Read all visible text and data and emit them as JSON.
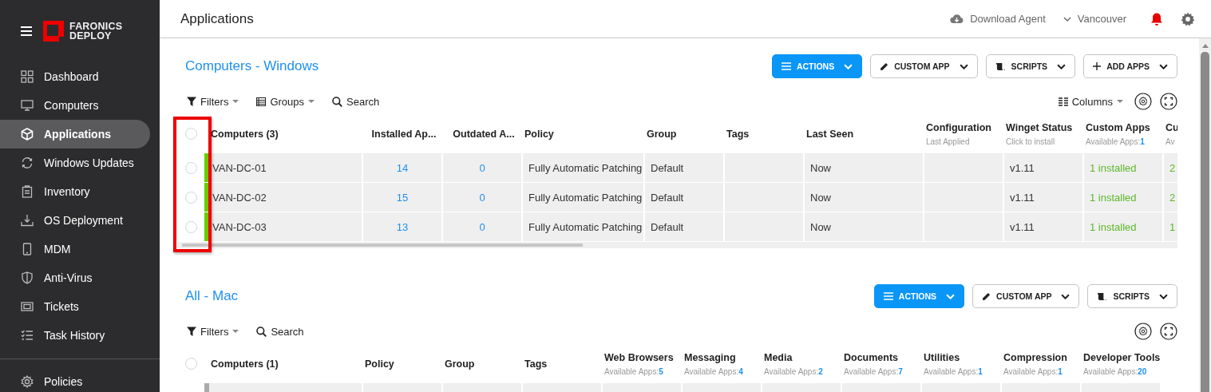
{
  "sidebar": {
    "logo": {
      "line_1": "FARONICS",
      "line_2": "DEPLOY"
    },
    "items": [
      {
        "label": "Dashboard",
        "kind": "dashboard",
        "selected": false
      },
      {
        "label": "Computers",
        "kind": "computers",
        "selected": false
      },
      {
        "label": "Applications",
        "kind": "applications",
        "selected": true
      },
      {
        "label": "Windows Updates",
        "kind": "updates",
        "selected": false
      },
      {
        "label": "Inventory",
        "kind": "inventory",
        "selected": false
      },
      {
        "label": "OS Deployment",
        "kind": "deployment",
        "selected": false
      },
      {
        "label": "MDM",
        "kind": "mdm",
        "selected": false
      },
      {
        "label": "Anti-Virus",
        "kind": "antivirus",
        "selected": false
      },
      {
        "label": "Tickets",
        "kind": "tickets",
        "selected": false
      },
      {
        "label": "Task History",
        "kind": "history",
        "selected": false
      }
    ],
    "footer_items": [
      {
        "label": "Policies",
        "kind": "policies",
        "selected": false
      }
    ]
  },
  "header": {
    "title": "Applications",
    "download_label": "Download Agent",
    "location": "Vancouver"
  },
  "sections": [
    {
      "title": "Computers - Windows",
      "buttons": [
        {
          "label": "ACTIONS",
          "kind": "actions"
        },
        {
          "label": "CUSTOM APP",
          "kind": "custom"
        },
        {
          "label": "SCRIPTS",
          "kind": "scripts"
        },
        {
          "label": "ADD APPS",
          "kind": "add"
        }
      ],
      "toolbar": [
        {
          "label": "Filters",
          "kind": "filters"
        },
        {
          "label": "Groups",
          "kind": "groups"
        },
        {
          "label": "Search",
          "kind": "search"
        }
      ],
      "columns_menu": {
        "label": "Columns"
      },
      "table": {
        "select_all": {
          "selected": false
        },
        "columns": [
          {
            "label": "Computers (3)",
            "kind": "name"
          },
          {
            "label": "Installed Ap...",
            "kind": "link"
          },
          {
            "label": "Outdated A...",
            "kind": "link"
          },
          {
            "label": "Policy",
            "kind": "text"
          },
          {
            "label": "Group",
            "kind": "text"
          },
          {
            "label": "Tags",
            "kind": "text"
          },
          {
            "label": "Last Seen",
            "kind": "text"
          },
          {
            "label": "Configuration",
            "sub": "Last Applied",
            "kind": "text"
          },
          {
            "label": "Winget Status",
            "sub": "Click to install",
            "kind": "text"
          },
          {
            "label": "Custom Apps",
            "sub": "Available Apps:",
            "sub_count": "1",
            "kind": "status"
          },
          {
            "label": "Cu",
            "sub": "Av",
            "kind": "status"
          }
        ],
        "rows": [
          {
            "selected": false,
            "color": "#66cc00",
            "cells": [
              "VAN-DC-01",
              "14",
              "0",
              "Fully Automatic Patching",
              "Default",
              null,
              "Now",
              null,
              "v1.11",
              "1 installed",
              "2"
            ]
          },
          {
            "selected": false,
            "color": "#66cc00",
            "cells": [
              "VAN-DC-02",
              "15",
              "0",
              "Fully Automatic Patching",
              "Default",
              null,
              "Now",
              null,
              "v1.11",
              "1 installed",
              "2"
            ]
          },
          {
            "selected": false,
            "color": "#66cc00",
            "cells": [
              "VAN-DC-03",
              "13",
              "0",
              "Fully Automatic Patching",
              "Default",
              null,
              "Now",
              null,
              "v1.11",
              "1 installed",
              "1"
            ]
          }
        ]
      }
    },
    {
      "title": "All - Mac",
      "buttons": [
        {
          "label": "ACTIONS",
          "kind": "actions"
        },
        {
          "label": "CUSTOM APP",
          "kind": "custom"
        },
        {
          "label": "SCRIPTS",
          "kind": "scripts"
        }
      ],
      "toolbar": [
        {
          "label": "Filters",
          "kind": "filters"
        },
        {
          "label": "Search",
          "kind": "search"
        }
      ],
      "table": {
        "select_all": {
          "selected": false
        },
        "columns": [
          {
            "label": "Computers (1)",
            "kind": "name"
          },
          {
            "label": "Policy",
            "kind": "text"
          },
          {
            "label": "Group",
            "kind": "text"
          },
          {
            "label": "Tags",
            "kind": "text"
          },
          {
            "label": "Web Browsers",
            "sub": "Available Apps:",
            "sub_count": "5",
            "kind": "status"
          },
          {
            "label": "Messaging",
            "sub": "Available Apps:",
            "sub_count": "4",
            "kind": "status"
          },
          {
            "label": "Media",
            "sub": "Available Apps:",
            "sub_count": "2",
            "kind": "status"
          },
          {
            "label": "Documents",
            "sub": "Available Apps:",
            "sub_count": "7",
            "kind": "status"
          },
          {
            "label": "Utilities",
            "sub": "Available Apps:",
            "sub_count": "1",
            "kind": "status"
          },
          {
            "label": "Compression",
            "sub": "Available Apps:",
            "sub_count": "1",
            "kind": "status"
          },
          {
            "label": "Developer Tools",
            "sub": "Available Apps:",
            "sub_count": "20",
            "kind": "status"
          }
        ],
        "rows": [
          {
            "color": "#aaaaaa",
            "cells": [
              null,
              null,
              null,
              null,
              null,
              null,
              null,
              null,
              null,
              null,
              null
            ]
          }
        ]
      }
    }
  ]
}
